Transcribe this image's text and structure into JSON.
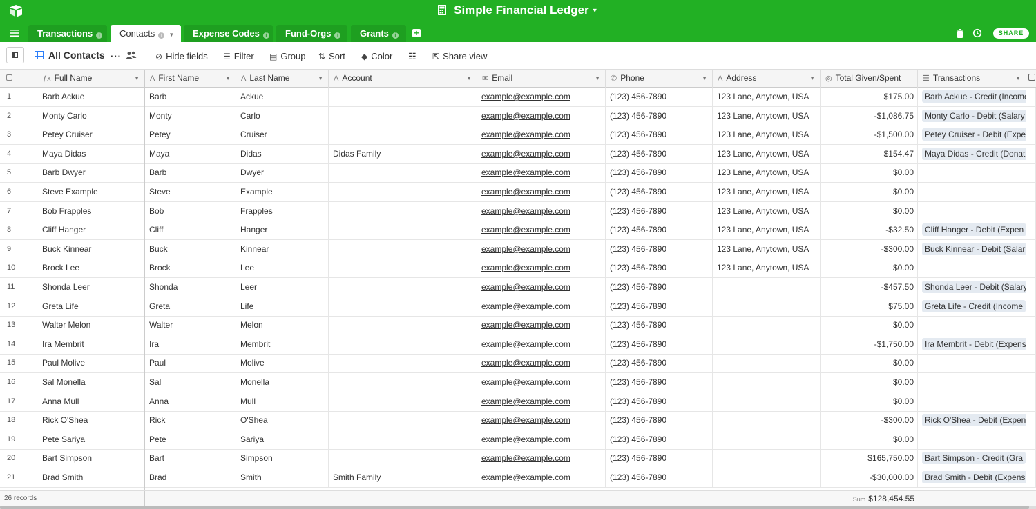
{
  "app": {
    "base_title": "Simple Financial Ledger",
    "share_label": "SHARE"
  },
  "tabs": [
    {
      "label": "Transactions",
      "active": false
    },
    {
      "label": "Contacts",
      "active": true
    },
    {
      "label": "Expense Codes",
      "active": false
    },
    {
      "label": "Fund-Orgs",
      "active": false
    },
    {
      "label": "Grants",
      "active": false
    }
  ],
  "toolbar": {
    "view_name": "All Contacts",
    "hide_fields": "Hide fields",
    "filter": "Filter",
    "group": "Group",
    "sort": "Sort",
    "color": "Color",
    "share_view": "Share view"
  },
  "columns": [
    {
      "label": "Full Name",
      "icon": "formula-icon"
    },
    {
      "label": "First Name",
      "icon": "text-icon"
    },
    {
      "label": "Last Name",
      "icon": "text-icon"
    },
    {
      "label": "Account",
      "icon": "text-icon"
    },
    {
      "label": "Email",
      "icon": "email-icon"
    },
    {
      "label": "Phone",
      "icon": "phone-icon"
    },
    {
      "label": "Address",
      "icon": "text-icon"
    },
    {
      "label": "Total Given/Spent",
      "icon": "rollup-icon"
    },
    {
      "label": "Transactions",
      "icon": "link-icon"
    }
  ],
  "rows": [
    {
      "n": "1",
      "full": "Barb Ackue",
      "first": "Barb",
      "last": "Ackue",
      "account": "",
      "email": "example@example.com",
      "phone": "(123) 456-7890",
      "address": "123 Lane, Anytown, USA",
      "total": "$175.00",
      "tx": "Barb Ackue - Credit (Income"
    },
    {
      "n": "2",
      "full": "Monty Carlo",
      "first": "Monty",
      "last": "Carlo",
      "account": "",
      "email": "example@example.com",
      "phone": "(123) 456-7890",
      "address": "123 Lane, Anytown, USA",
      "total": "-$1,086.75",
      "tx": "Monty Carlo - Debit (Salary"
    },
    {
      "n": "3",
      "full": "Petey Cruiser",
      "first": "Petey",
      "last": "Cruiser",
      "account": "",
      "email": "example@example.com",
      "phone": "(123) 456-7890",
      "address": "123 Lane, Anytown, USA",
      "total": "-$1,500.00",
      "tx": "Petey Cruiser - Debit (Expe"
    },
    {
      "n": "4",
      "full": "Maya Didas",
      "first": "Maya",
      "last": "Didas",
      "account": "Didas Family",
      "email": "example@example.com",
      "phone": "(123) 456-7890",
      "address": "123 Lane, Anytown, USA",
      "total": "$154.47",
      "tx": "Maya Didas - Credit (Donat"
    },
    {
      "n": "5",
      "full": "Barb Dwyer",
      "first": "Barb",
      "last": "Dwyer",
      "account": "",
      "email": "example@example.com",
      "phone": "(123) 456-7890",
      "address": "123 Lane, Anytown, USA",
      "total": "$0.00",
      "tx": ""
    },
    {
      "n": "6",
      "full": "Steve Example",
      "first": "Steve",
      "last": "Example",
      "account": "",
      "email": "example@example.com",
      "phone": "(123) 456-7890",
      "address": "123 Lane, Anytown, USA",
      "total": "$0.00",
      "tx": ""
    },
    {
      "n": "7",
      "full": "Bob Frapples",
      "first": "Bob",
      "last": "Frapples",
      "account": "",
      "email": "example@example.com",
      "phone": "(123) 456-7890",
      "address": "123 Lane, Anytown, USA",
      "total": "$0.00",
      "tx": ""
    },
    {
      "n": "8",
      "full": "Cliff Hanger",
      "first": "Cliff",
      "last": "Hanger",
      "account": "",
      "email": "example@example.com",
      "phone": "(123) 456-7890",
      "address": "123 Lane, Anytown, USA",
      "total": "-$32.50",
      "tx": "Cliff Hanger - Debit (Expen"
    },
    {
      "n": "9",
      "full": "Buck Kinnear",
      "first": "Buck",
      "last": "Kinnear",
      "account": "",
      "email": "example@example.com",
      "phone": "(123) 456-7890",
      "address": "123 Lane, Anytown, USA",
      "total": "-$300.00",
      "tx": "Buck Kinnear - Debit (Salar"
    },
    {
      "n": "10",
      "full": "Brock Lee",
      "first": "Brock",
      "last": "Lee",
      "account": "",
      "email": "example@example.com",
      "phone": "(123) 456-7890",
      "address": "123 Lane, Anytown, USA",
      "total": "$0.00",
      "tx": ""
    },
    {
      "n": "11",
      "full": "Shonda Leer",
      "first": "Shonda",
      "last": "Leer",
      "account": "",
      "email": "example@example.com",
      "phone": "(123) 456-7890",
      "address": "",
      "total": "-$457.50",
      "tx": "Shonda Leer - Debit (Salary"
    },
    {
      "n": "12",
      "full": "Greta Life",
      "first": "Greta",
      "last": "Life",
      "account": "",
      "email": "example@example.com",
      "phone": "(123) 456-7890",
      "address": "",
      "total": "$75.00",
      "tx": "Greta Life - Credit (Income"
    },
    {
      "n": "13",
      "full": "Walter Melon",
      "first": "Walter",
      "last": "Melon",
      "account": "",
      "email": "example@example.com",
      "phone": "(123) 456-7890",
      "address": "",
      "total": "$0.00",
      "tx": ""
    },
    {
      "n": "14",
      "full": "Ira Membrit",
      "first": "Ira",
      "last": "Membrit",
      "account": "",
      "email": "example@example.com",
      "phone": "(123) 456-7890",
      "address": "",
      "total": "-$1,750.00",
      "tx": "Ira Membrit - Debit (Expens"
    },
    {
      "n": "15",
      "full": "Paul Molive",
      "first": "Paul",
      "last": "Molive",
      "account": "",
      "email": "example@example.com",
      "phone": "(123) 456-7890",
      "address": "",
      "total": "$0.00",
      "tx": ""
    },
    {
      "n": "16",
      "full": "Sal Monella",
      "first": "Sal",
      "last": "Monella",
      "account": "",
      "email": "example@example.com",
      "phone": "(123) 456-7890",
      "address": "",
      "total": "$0.00",
      "tx": ""
    },
    {
      "n": "17",
      "full": "Anna Mull",
      "first": "Anna",
      "last": "Mull",
      "account": "",
      "email": "example@example.com",
      "phone": "(123) 456-7890",
      "address": "",
      "total": "$0.00",
      "tx": ""
    },
    {
      "n": "18",
      "full": "Rick O'Shea",
      "first": "Rick",
      "last": "O'Shea",
      "account": "",
      "email": "example@example.com",
      "phone": "(123) 456-7890",
      "address": "",
      "total": "-$300.00",
      "tx": "Rick O'Shea - Debit (Expen"
    },
    {
      "n": "19",
      "full": "Pete Sariya",
      "first": "Pete",
      "last": "Sariya",
      "account": "",
      "email": "example@example.com",
      "phone": "(123) 456-7890",
      "address": "",
      "total": "$0.00",
      "tx": ""
    },
    {
      "n": "20",
      "full": "Bart Simpson",
      "first": "Bart",
      "last": "Simpson",
      "account": "",
      "email": "example@example.com",
      "phone": "(123) 456-7890",
      "address": "",
      "total": "$165,750.00",
      "tx": "Bart Simpson - Credit (Gra"
    },
    {
      "n": "21",
      "full": "Brad Smith",
      "first": "Brad",
      "last": "Smith",
      "account": "Smith Family",
      "email": "example@example.com",
      "phone": "(123) 456-7890",
      "address": "",
      "total": "-$30,000.00",
      "tx": "Brad Smith - Debit (Expens"
    }
  ],
  "footer": {
    "record_count": "26 records",
    "sum_label": "Sum",
    "sum_value": "$128,454.55"
  }
}
